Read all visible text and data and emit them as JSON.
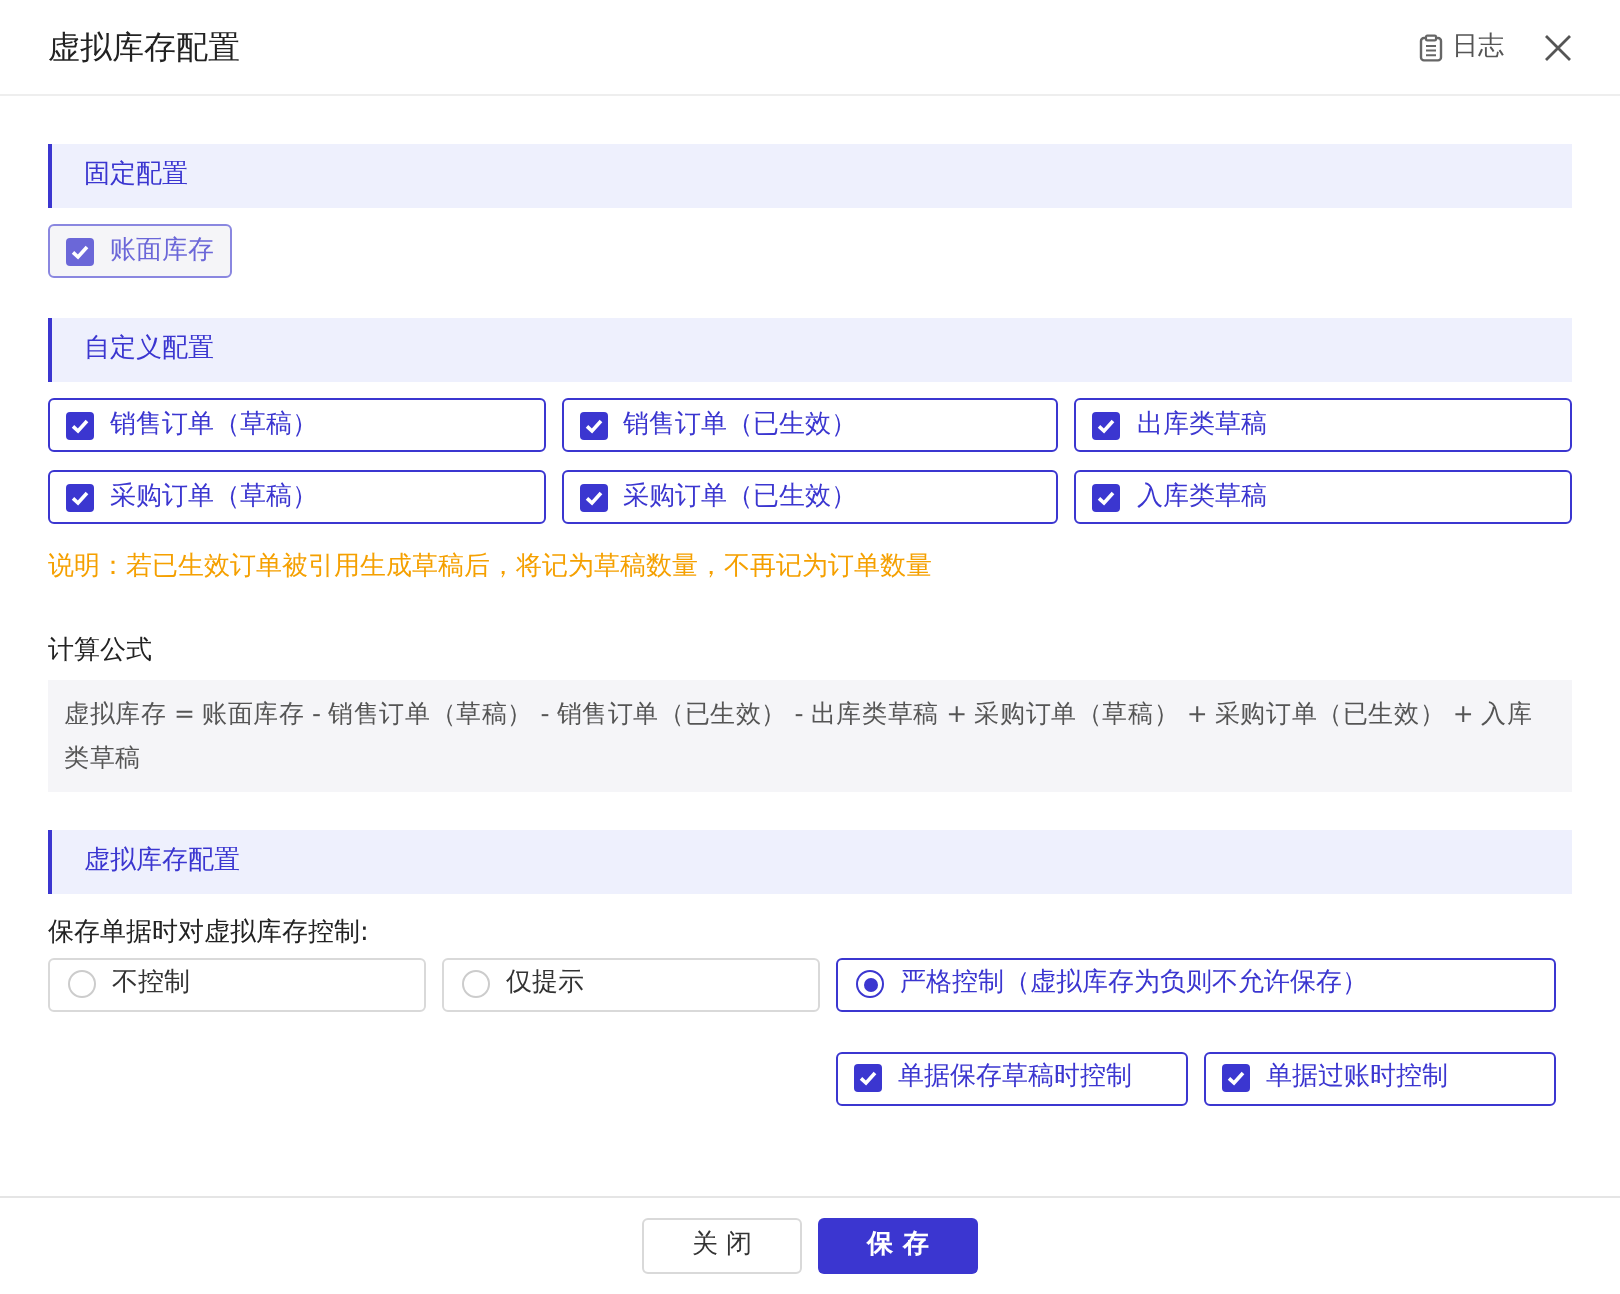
{
  "dialog": {
    "title": "虚拟库存配置",
    "log_link": "日志"
  },
  "fixed_section": {
    "title": "固定配置",
    "items": [
      {
        "label": "账面库存",
        "checked": true,
        "disabled": true
      }
    ]
  },
  "custom_section": {
    "title": "自定义配置",
    "items": [
      {
        "label": "销售订单（草稿）",
        "checked": true
      },
      {
        "label": "销售订单（已生效）",
        "checked": true
      },
      {
        "label": "出库类草稿",
        "checked": true
      },
      {
        "label": "采购订单（草稿）",
        "checked": true
      },
      {
        "label": "采购订单（已生效）",
        "checked": true
      },
      {
        "label": "入库类草稿",
        "checked": true
      }
    ],
    "note": "说明：若已生效订单被引用生成草稿后，将记为草稿数量，不再记为订单数量",
    "formula_label": "计算公式",
    "formula": "虚拟库存 = 账面库存 - 销售订单（草稿） - 销售订单（已生效） - 出库类草稿 + 采购订单（草稿） + 采购订单（已生效） + 入库类草稿"
  },
  "virtual_section": {
    "title": "虚拟库存配置",
    "control_label": "保存单据时对虚拟库存控制:",
    "options": [
      {
        "label": "不控制",
        "selected": false
      },
      {
        "label": "仅提示",
        "selected": false
      },
      {
        "label": "严格控制（虚拟库存为负则不允许保存）",
        "selected": true
      }
    ],
    "sub_options": [
      {
        "label": "单据保存草稿时控制",
        "checked": true
      },
      {
        "label": "单据过账时控制",
        "checked": true
      }
    ]
  },
  "buttons": [
    {
      "label": "关 闭",
      "kind": "secondary"
    },
    {
      "label": "保 存",
      "kind": "primary"
    }
  ]
}
